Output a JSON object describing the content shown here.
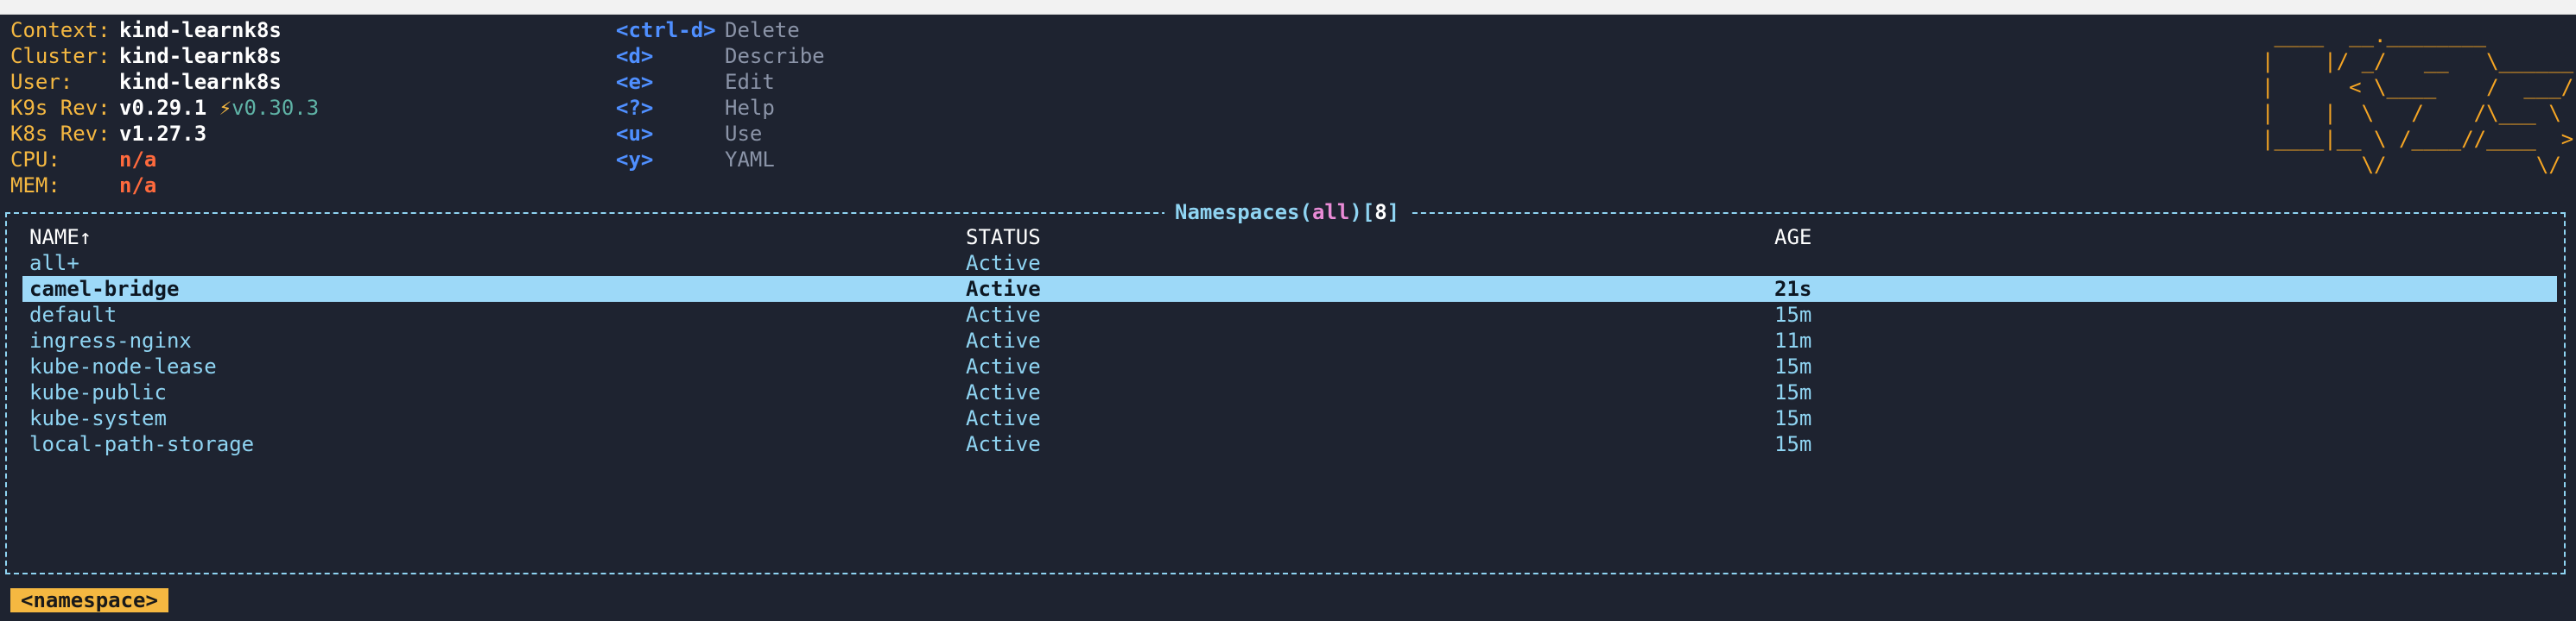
{
  "info": [
    {
      "key": "Context:",
      "value": "kind-learnk8s"
    },
    {
      "key": "Cluster:",
      "value": "kind-learnk8s"
    },
    {
      "key": "User:",
      "value": "kind-learnk8s"
    },
    {
      "key": "K9s Rev:",
      "value": "v0.29.1",
      "bolt": "⚡",
      "new_version": "v0.30.3"
    },
    {
      "key": "K8s Rev:",
      "value": "v1.27.3"
    },
    {
      "key": "CPU:",
      "value": "n/a"
    },
    {
      "key": "MEM:",
      "value": "n/a"
    }
  ],
  "hotkeys": [
    {
      "key": "<ctrl-d>",
      "desc": "Delete"
    },
    {
      "key": "<d>",
      "desc": "Describe"
    },
    {
      "key": "<e>",
      "desc": "Edit"
    },
    {
      "key": "<?>",
      "desc": "Help"
    },
    {
      "key": "<u>",
      "desc": "Use"
    },
    {
      "key": "<y>",
      "desc": "YAML"
    }
  ],
  "logo_ascii": " ____  __.________       \n|    |/ _/   __   \\______\n|      < \\____    /  ___/\n|    |  \\   /    /\\___ \\ \n|____|__ \\ /____//____  >\n        \\/            \\/ ",
  "panel": {
    "title_prefix": "Namespaces(",
    "filter": "all",
    "title_mid": ")[",
    "count": "8",
    "title_suffix": "]"
  },
  "table": {
    "headers": {
      "name": "NAME↑",
      "status": "STATUS",
      "age": "AGE"
    },
    "rows": [
      {
        "name": "all+",
        "status": "Active",
        "age": ""
      },
      {
        "name": "camel-bridge",
        "status": "Active",
        "age": "21s",
        "selected": true
      },
      {
        "name": "default",
        "status": "Active",
        "age": "15m"
      },
      {
        "name": "ingress-nginx",
        "status": "Active",
        "age": "11m"
      },
      {
        "name": "kube-node-lease",
        "status": "Active",
        "age": "15m"
      },
      {
        "name": "kube-public",
        "status": "Active",
        "age": "15m"
      },
      {
        "name": "kube-system",
        "status": "Active",
        "age": "15m"
      },
      {
        "name": "local-path-storage",
        "status": "Active",
        "age": "15m"
      }
    ]
  },
  "breadcrumb": "<namespace>",
  "colors": {
    "background": "#1e2330",
    "info_key": "#f5b841",
    "hotkey": "#4f8fff",
    "logo": "#f5a524",
    "table_text": "#8fd4f2",
    "selected_row": "#9dd9f8",
    "metric_na": "#ff6a3d",
    "filter": "#e98bd6"
  }
}
